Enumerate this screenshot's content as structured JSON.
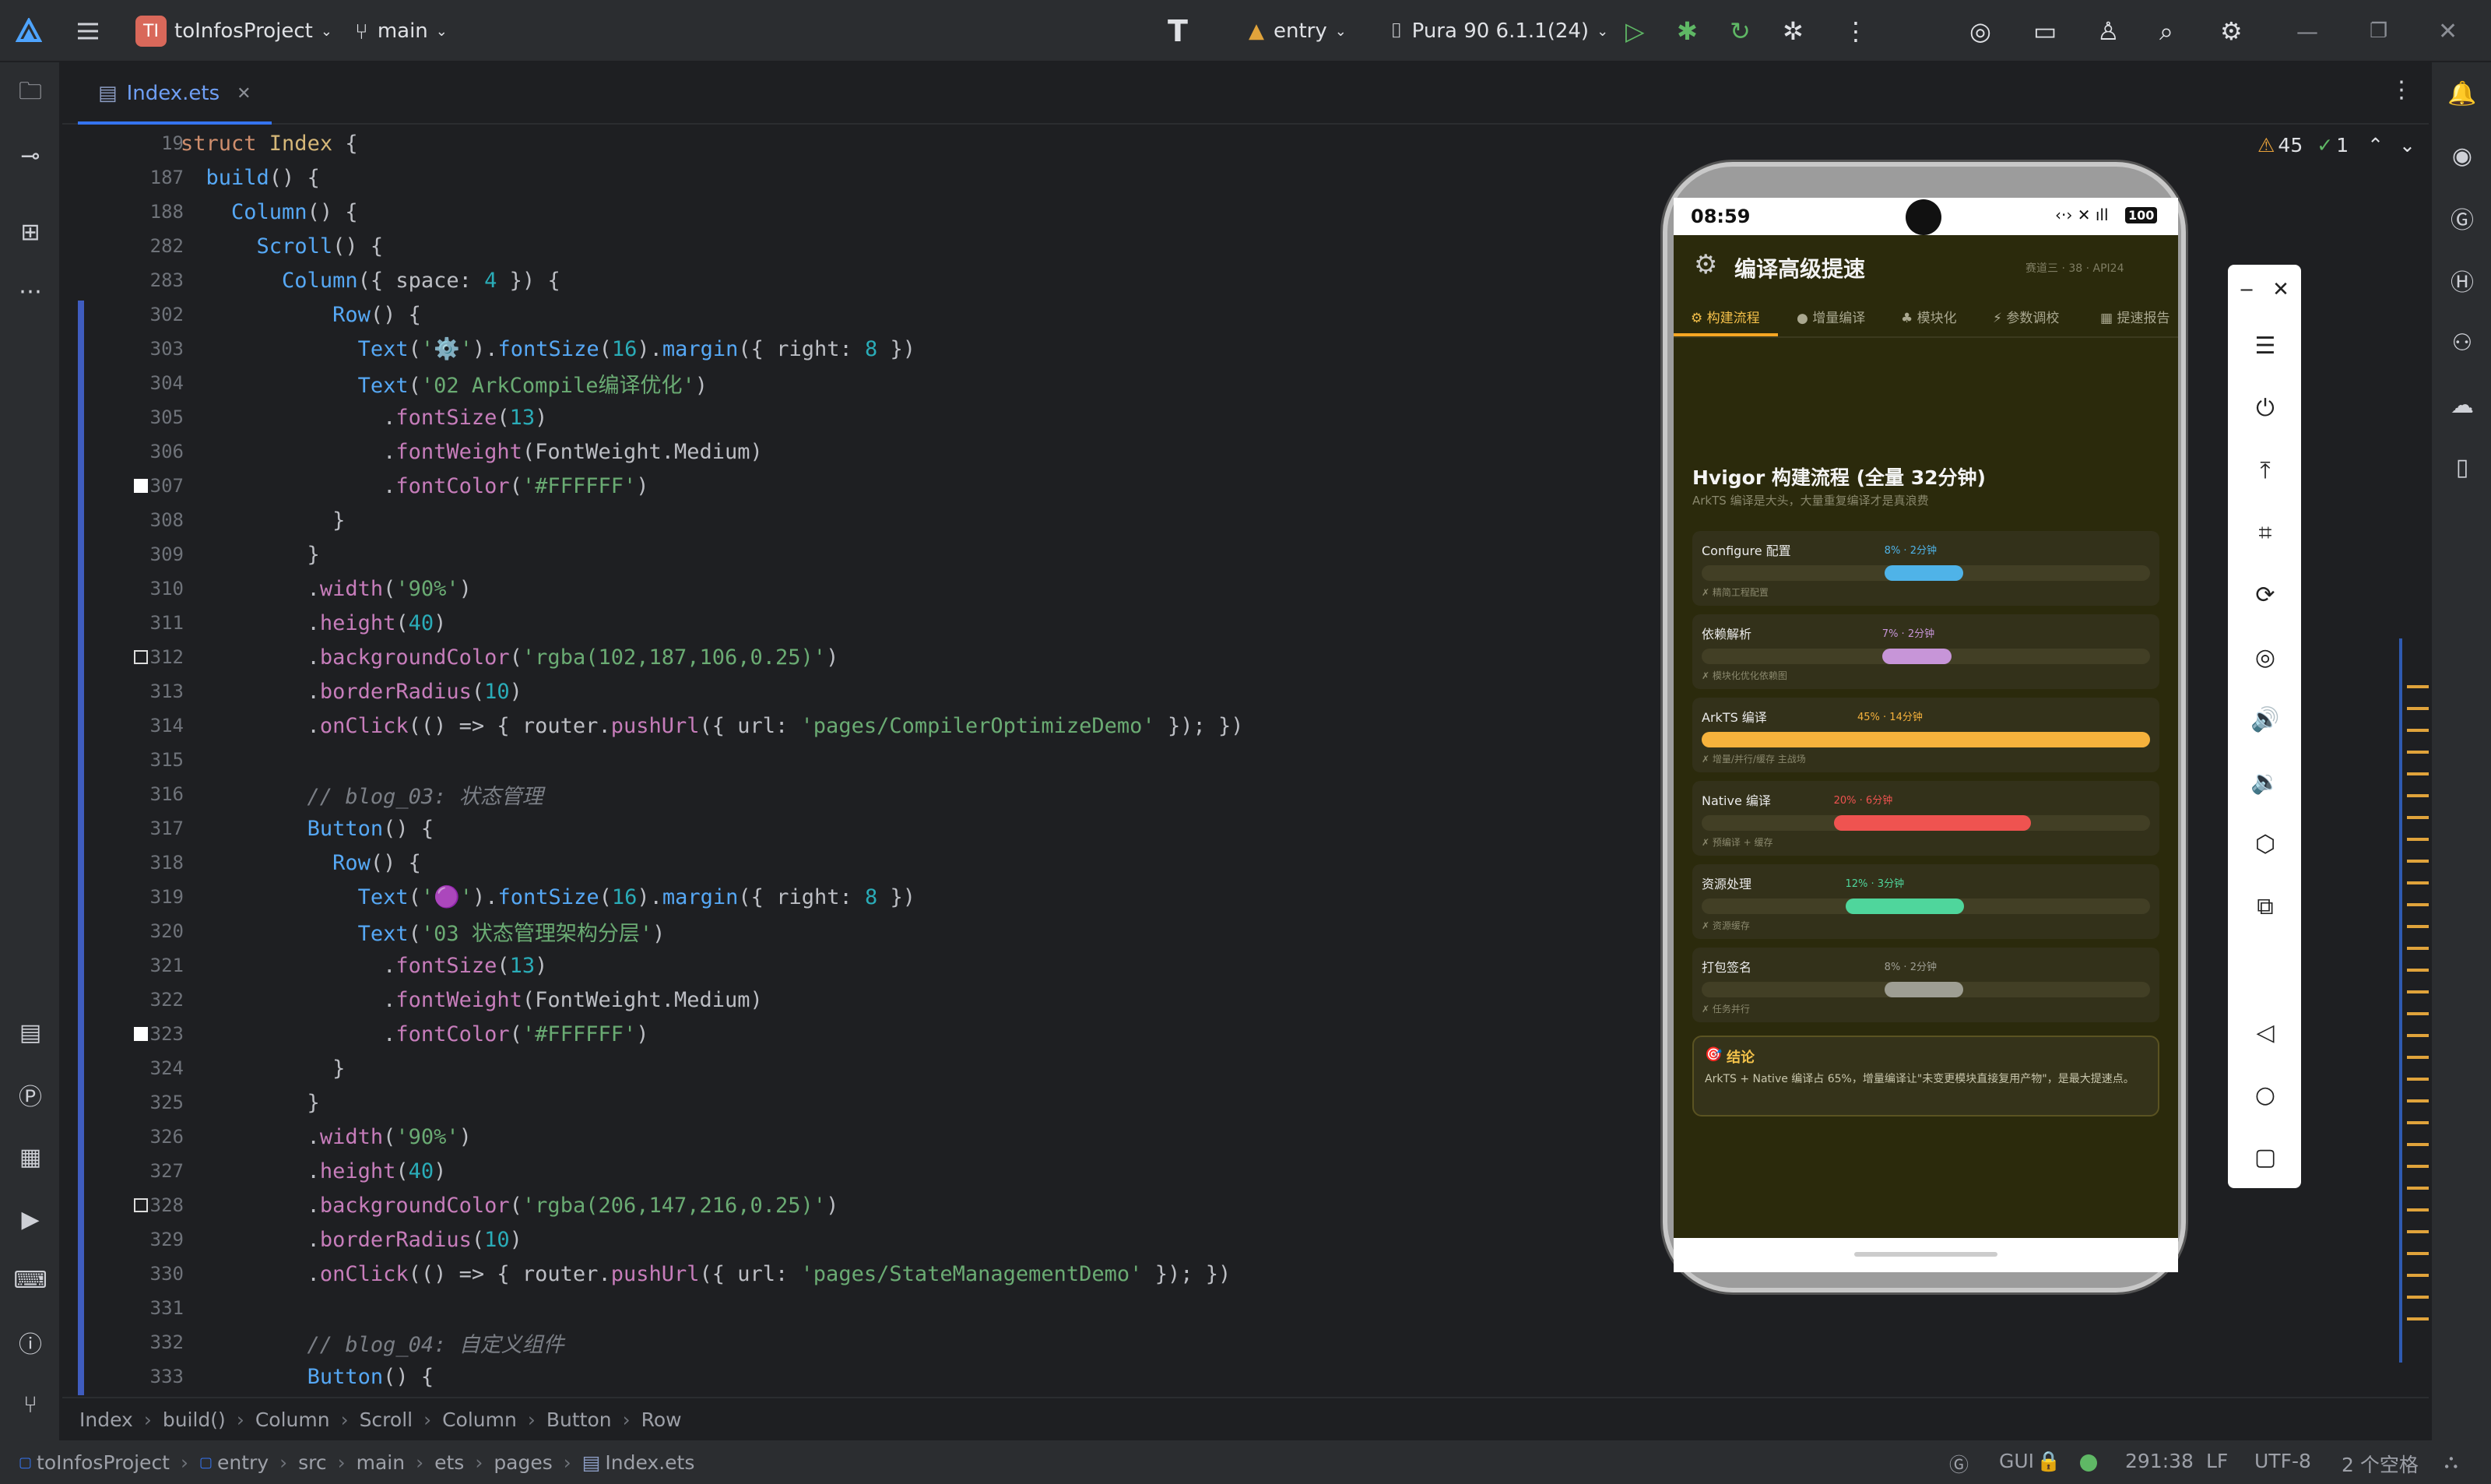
{
  "titlebar": {
    "project_badge": "TI",
    "project": "toInfosProject",
    "branch": "main",
    "module": "entry",
    "device": "Pura 90 6.1.1(24)"
  },
  "tab": {
    "file": "Index.ets"
  },
  "editor_meta": {
    "warnings": "45",
    "checks": "1"
  },
  "code_lines": [
    {
      "n": "19",
      "segs": [
        [
          "kw",
          "struct "
        ],
        [
          "type",
          "Index"
        ],
        [
          "plain",
          " {"
        ]
      ]
    },
    {
      "n": "187",
      "segs": [
        [
          "plain",
          "  "
        ],
        [
          "fn",
          "build"
        ],
        [
          "plain",
          "() {"
        ]
      ]
    },
    {
      "n": "188",
      "segs": [
        [
          "plain",
          "    "
        ],
        [
          "fn",
          "Column"
        ],
        [
          "plain",
          "() {"
        ]
      ]
    },
    {
      "n": "282",
      "segs": [
        [
          "plain",
          "      "
        ],
        [
          "fn",
          "Scroll"
        ],
        [
          "plain",
          "() {"
        ]
      ]
    },
    {
      "n": "283",
      "segs": [
        [
          "plain",
          "        "
        ],
        [
          "fn",
          "Column"
        ],
        [
          "plain",
          "({ space: "
        ],
        [
          "num",
          "4"
        ],
        [
          "plain",
          " }) {"
        ]
      ]
    },
    {
      "n": "302",
      "segs": [
        [
          "plain",
          "            "
        ],
        [
          "fn",
          "Row"
        ],
        [
          "plain",
          "() {"
        ]
      ]
    },
    {
      "n": "303",
      "segs": [
        [
          "plain",
          "              "
        ],
        [
          "fn",
          "Text"
        ],
        [
          "plain",
          "("
        ],
        [
          "str",
          "'⚙️'"
        ],
        [
          "plain",
          ")."
        ],
        [
          "fn",
          "fontSize"
        ],
        [
          "plain",
          "("
        ],
        [
          "num",
          "16"
        ],
        [
          "plain",
          ")."
        ],
        [
          "fn",
          "margin"
        ],
        [
          "plain",
          "({ right: "
        ],
        [
          "num",
          "8"
        ],
        [
          "plain",
          " })"
        ]
      ]
    },
    {
      "n": "304",
      "segs": [
        [
          "plain",
          "              "
        ],
        [
          "fn",
          "Text"
        ],
        [
          "plain",
          "("
        ],
        [
          "str",
          "'02 ArkCompile编译优化'"
        ],
        [
          "plain",
          ")"
        ]
      ]
    },
    {
      "n": "305",
      "segs": [
        [
          "plain",
          "                ."
        ],
        [
          "prop",
          "fontSize"
        ],
        [
          "plain",
          "("
        ],
        [
          "num",
          "13"
        ],
        [
          "plain",
          ")"
        ]
      ]
    },
    {
      "n": "306",
      "segs": [
        [
          "plain",
          "                ."
        ],
        [
          "prop",
          "fontWeight"
        ],
        [
          "plain",
          "(FontWeight.Medium)"
        ]
      ]
    },
    {
      "n": "307",
      "segs": [
        [
          "plain",
          "                ."
        ],
        [
          "prop",
          "fontColor"
        ],
        [
          "plain",
          "("
        ],
        [
          "str",
          "'#FFFFFF'"
        ],
        [
          "plain",
          ")"
        ]
      ]
    },
    {
      "n": "308",
      "segs": [
        [
          "plain",
          "            }"
        ]
      ]
    },
    {
      "n": "309",
      "segs": [
        [
          "plain",
          "          }"
        ]
      ]
    },
    {
      "n": "310",
      "segs": [
        [
          "plain",
          "          ."
        ],
        [
          "prop",
          "width"
        ],
        [
          "plain",
          "("
        ],
        [
          "str",
          "'90%'"
        ],
        [
          "plain",
          ")"
        ]
      ]
    },
    {
      "n": "311",
      "segs": [
        [
          "plain",
          "          ."
        ],
        [
          "prop",
          "height"
        ],
        [
          "plain",
          "("
        ],
        [
          "num",
          "40"
        ],
        [
          "plain",
          ")"
        ]
      ]
    },
    {
      "n": "312",
      "segs": [
        [
          "plain",
          "          ."
        ],
        [
          "prop",
          "backgroundColor"
        ],
        [
          "plain",
          "("
        ],
        [
          "str",
          "'rgba(102,187,106,0.25)'"
        ],
        [
          "plain",
          ")"
        ]
      ]
    },
    {
      "n": "313",
      "segs": [
        [
          "plain",
          "          ."
        ],
        [
          "prop",
          "borderRadius"
        ],
        [
          "plain",
          "("
        ],
        [
          "num",
          "10"
        ],
        [
          "plain",
          ")"
        ]
      ]
    },
    {
      "n": "314",
      "segs": [
        [
          "plain",
          "          ."
        ],
        [
          "prop",
          "onClick"
        ],
        [
          "plain",
          "(() => { router."
        ],
        [
          "prop",
          "pushUrl"
        ],
        [
          "plain",
          "({ url: "
        ],
        [
          "str",
          "'pages/CompilerOptimizeDemo'"
        ],
        [
          "plain",
          " }); })"
        ]
      ]
    },
    {
      "n": "315",
      "segs": [
        [
          "plain",
          ""
        ]
      ]
    },
    {
      "n": "316",
      "segs": [
        [
          "cm",
          "          // blog_03: 状态管理"
        ]
      ]
    },
    {
      "n": "317",
      "segs": [
        [
          "plain",
          "          "
        ],
        [
          "fn",
          "Button"
        ],
        [
          "plain",
          "() {"
        ]
      ]
    },
    {
      "n": "318",
      "segs": [
        [
          "plain",
          "            "
        ],
        [
          "fn",
          "Row"
        ],
        [
          "plain",
          "() {"
        ]
      ]
    },
    {
      "n": "319",
      "segs": [
        [
          "plain",
          "              "
        ],
        [
          "fn",
          "Text"
        ],
        [
          "plain",
          "("
        ],
        [
          "str",
          "'🟣'"
        ],
        [
          "plain",
          ")."
        ],
        [
          "fn",
          "fontSize"
        ],
        [
          "plain",
          "("
        ],
        [
          "num",
          "16"
        ],
        [
          "plain",
          ")."
        ],
        [
          "fn",
          "margin"
        ],
        [
          "plain",
          "({ right: "
        ],
        [
          "num",
          "8"
        ],
        [
          "plain",
          " })"
        ]
      ]
    },
    {
      "n": "320",
      "segs": [
        [
          "plain",
          "              "
        ],
        [
          "fn",
          "Text"
        ],
        [
          "plain",
          "("
        ],
        [
          "str",
          "'03 状态管理架构分层'"
        ],
        [
          "plain",
          ")"
        ]
      ]
    },
    {
      "n": "321",
      "segs": [
        [
          "plain",
          "                ."
        ],
        [
          "prop",
          "fontSize"
        ],
        [
          "plain",
          "("
        ],
        [
          "num",
          "13"
        ],
        [
          "plain",
          ")"
        ]
      ]
    },
    {
      "n": "322",
      "segs": [
        [
          "plain",
          "                ."
        ],
        [
          "prop",
          "fontWeight"
        ],
        [
          "plain",
          "(FontWeight.Medium)"
        ]
      ]
    },
    {
      "n": "323",
      "segs": [
        [
          "plain",
          "                ."
        ],
        [
          "prop",
          "fontColor"
        ],
        [
          "plain",
          "("
        ],
        [
          "str",
          "'#FFFFFF'"
        ],
        [
          "plain",
          ")"
        ]
      ]
    },
    {
      "n": "324",
      "segs": [
        [
          "plain",
          "            }"
        ]
      ]
    },
    {
      "n": "325",
      "segs": [
        [
          "plain",
          "          }"
        ]
      ]
    },
    {
      "n": "326",
      "segs": [
        [
          "plain",
          "          ."
        ],
        [
          "prop",
          "width"
        ],
        [
          "plain",
          "("
        ],
        [
          "str",
          "'90%'"
        ],
        [
          "plain",
          ")"
        ]
      ]
    },
    {
      "n": "327",
      "segs": [
        [
          "plain",
          "          ."
        ],
        [
          "prop",
          "height"
        ],
        [
          "plain",
          "("
        ],
        [
          "num",
          "40"
        ],
        [
          "plain",
          ")"
        ]
      ]
    },
    {
      "n": "328",
      "segs": [
        [
          "plain",
          "          ."
        ],
        [
          "prop",
          "backgroundColor"
        ],
        [
          "plain",
          "("
        ],
        [
          "str",
          "'rgba(206,147,216,0.25)'"
        ],
        [
          "plain",
          ")"
        ]
      ]
    },
    {
      "n": "329",
      "segs": [
        [
          "plain",
          "          ."
        ],
        [
          "prop",
          "borderRadius"
        ],
        [
          "plain",
          "("
        ],
        [
          "num",
          "10"
        ],
        [
          "plain",
          ")"
        ]
      ]
    },
    {
      "n": "330",
      "segs": [
        [
          "plain",
          "          ."
        ],
        [
          "prop",
          "onClick"
        ],
        [
          "plain",
          "(() => { router."
        ],
        [
          "prop",
          "pushUrl"
        ],
        [
          "plain",
          "({ url: "
        ],
        [
          "str",
          "'pages/StateManagementDemo'"
        ],
        [
          "plain",
          " }); })"
        ]
      ]
    },
    {
      "n": "331",
      "segs": [
        [
          "plain",
          ""
        ]
      ]
    },
    {
      "n": "332",
      "segs": [
        [
          "cm",
          "          // blog_04: 自定义组件"
        ]
      ]
    },
    {
      "n": "333",
      "segs": [
        [
          "plain",
          "          "
        ],
        [
          "fn",
          "Button"
        ],
        [
          "plain",
          "() {"
        ]
      ]
    }
  ],
  "breadcrumb": [
    "Index",
    "build()",
    "Column",
    "Scroll",
    "Column",
    "Button",
    "Row"
  ],
  "status": {
    "path": [
      "toInfosProject",
      "entry",
      "src",
      "main",
      "ets",
      "pages",
      "Index.ets"
    ],
    "gui": "GUI",
    "position": "291:38",
    "line_sep": "LF",
    "encoding": "UTF-8",
    "indent": "2 个空格"
  },
  "phone": {
    "time": "08:59",
    "battery": "100",
    "app_title": "编译高级提速",
    "app_meta": "赛道三 · 38 · API24",
    "tabs": [
      "构建流程",
      "增量编译",
      "模块化",
      "参数调校",
      "提速报告"
    ],
    "section_title": "Hvigor 构建流程 (全量 32分钟)",
    "section_sub": "ArkTS 编译是大头，大量重复编译才是真浪费",
    "stages": [
      {
        "name": "Configure 配置",
        "pct": "8% · 2分钟",
        "hint": "✗ 精简工程配置",
        "color": "#4fb3e8",
        "fraction": 0.08
      },
      {
        "name": "依赖解析",
        "pct": "7% · 2分钟",
        "hint": "✗ 模块化优化依赖图",
        "color": "#c795d8",
        "fraction": 0.07
      },
      {
        "name": "ArkTS 编译",
        "pct": "45% · 14分钟",
        "hint": "✗ 增量/并行/缓存 主战场",
        "color": "#f6b23c",
        "fraction": 0.45
      },
      {
        "name": "Native 编译",
        "pct": "20% · 6分钟",
        "hint": "✗ 预编译 + 缓存",
        "color": "#ef5350",
        "fraction": 0.2
      },
      {
        "name": "资源处理",
        "pct": "12% · 3分钟",
        "hint": "✗ 资源缓存",
        "color": "#4fd69c",
        "fraction": 0.12
      },
      {
        "name": "打包签名",
        "pct": "8% · 2分钟",
        "hint": "✗ 任务并行",
        "color": "#9e9e93",
        "fraction": 0.08
      }
    ],
    "conclusion_title": "结论",
    "conclusion_text": "ArkTS + Native 编译占 65%，增量编译让\"未变更模块直接复用产物\"，是最大提速点。"
  }
}
